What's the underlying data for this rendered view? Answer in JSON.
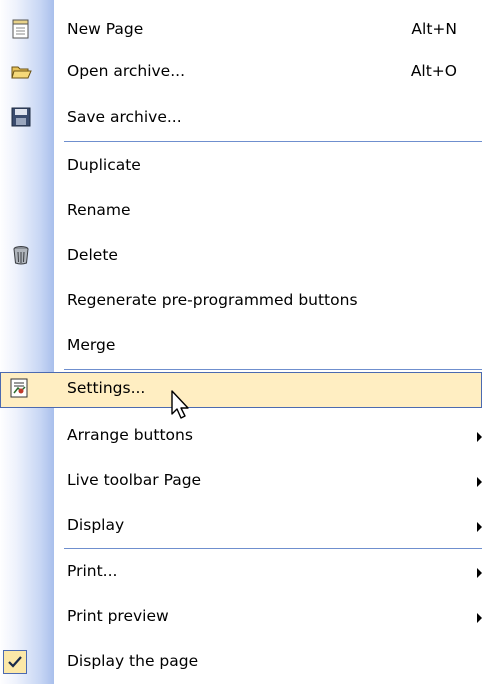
{
  "menu": {
    "items": [
      {
        "label": "New Page",
        "shortcut": "Alt+N",
        "icon": "new-page-icon"
      },
      {
        "label": "Open archive...",
        "shortcut": "Alt+O",
        "icon": "open-folder-icon"
      },
      {
        "label": "Save archive...",
        "icon": "floppy-disk-icon"
      },
      {
        "label": "Duplicate"
      },
      {
        "label": "Rename"
      },
      {
        "label": "Delete",
        "icon": "trash-can-icon"
      },
      {
        "label": "Regenerate pre-programmed buttons"
      },
      {
        "label": "Merge"
      },
      {
        "label": "Settings...",
        "icon": "settings-sheet-icon",
        "highlighted": true
      },
      {
        "label": "Arrange buttons",
        "submenu": true
      },
      {
        "label": "Live toolbar Page",
        "submenu": true
      },
      {
        "label": "Display",
        "submenu": true
      },
      {
        "label": "Print...",
        "submenu": true
      },
      {
        "label": "Print preview",
        "submenu": true
      },
      {
        "label": "Display the page",
        "icon": "checkmark-icon",
        "checked": true
      }
    ]
  },
  "colors": {
    "highlight_bg": "#ffeec2",
    "highlight_border": "#4c6ab0",
    "separator": "#6f8fce",
    "check_bg": "#fce8a8"
  }
}
